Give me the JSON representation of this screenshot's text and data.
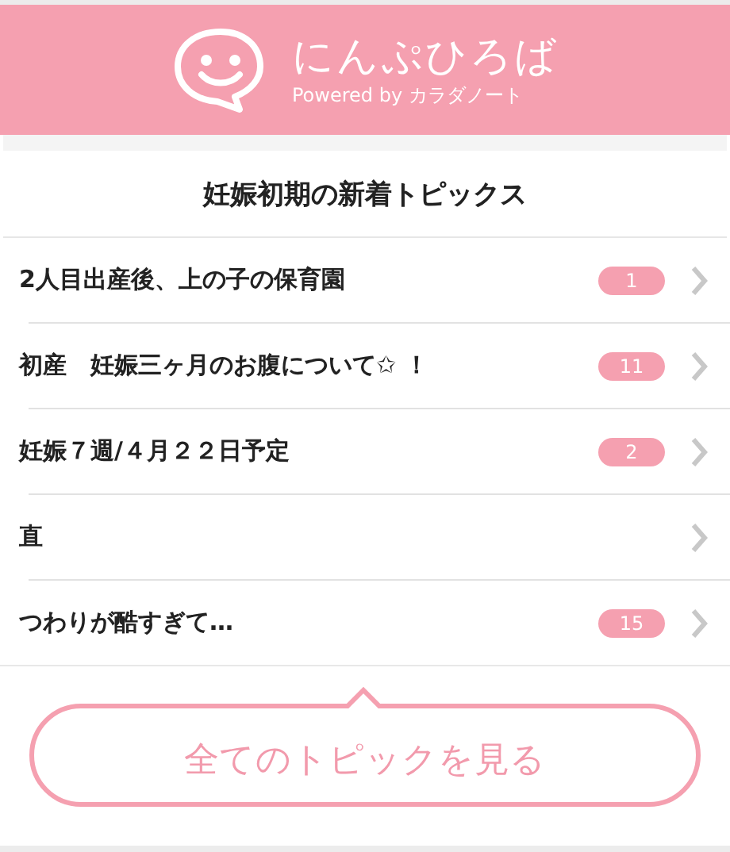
{
  "header": {
    "title": "にんぷひろば",
    "subtitle": "Powered by カラダノート"
  },
  "section": {
    "title": "妊娠初期の新着トピックス"
  },
  "topics": [
    {
      "title": "2人目出産後、上の子の保育園",
      "count": "1"
    },
    {
      "title": "初産　妊娠三ヶ月のお腹について✩ ！",
      "count": "11"
    },
    {
      "title": "妊娠７週/４月２２日予定",
      "count": "2"
    },
    {
      "title": "直"
    },
    {
      "title": "つわりが酷すぎて…",
      "count": "15"
    }
  ],
  "more_button": {
    "label": "全てのトピックを見る"
  }
}
